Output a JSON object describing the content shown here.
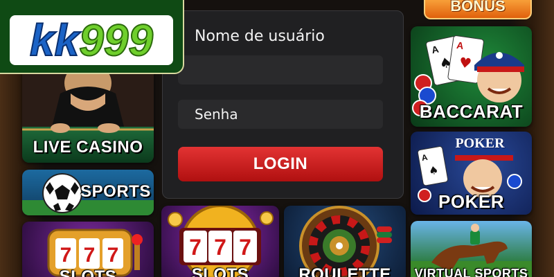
{
  "brand": {
    "logo_kk": "kk",
    "logo_999": "999"
  },
  "bonus": {
    "label": "BONUS"
  },
  "login": {
    "username_label": "Nome de usuário",
    "username_value": "",
    "password_label": "Senha",
    "password_placeholder": "Senha",
    "login_button": "LOGIN"
  },
  "tiles": {
    "live_casino": "LIVE CASINO",
    "sports": "SPORTS",
    "slots_left": "SLOTS",
    "slots_center": "SLOTS",
    "roulette": "ROULETTE",
    "baccarat": "BACCARAT",
    "poker": "POKER",
    "poker_sign": "POKER",
    "virtual_sports": "VIRTUAL SPORTS"
  },
  "colors": {
    "brand_blue": "#1b63c6",
    "brand_green": "#6fcf2c",
    "login_red": "#d42020",
    "panel_bg": "#202022"
  }
}
